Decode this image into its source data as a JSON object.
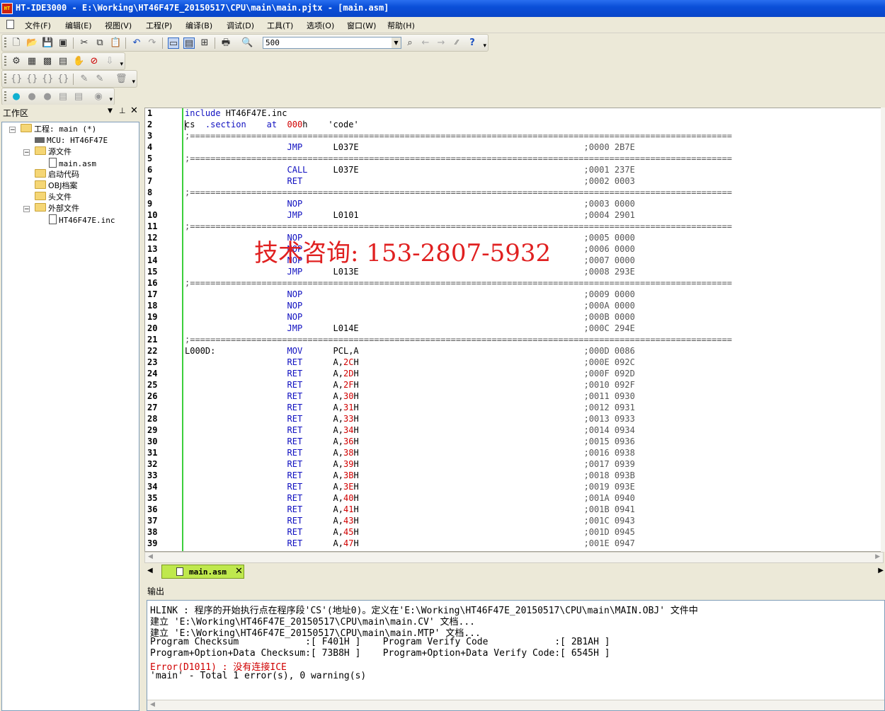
{
  "window": {
    "app_icon_text": "HT",
    "title": "HT-IDE3000 - E:\\Working\\HT46F47E_20150517\\CPU\\main\\main.pjtx - [main.asm]"
  },
  "menu": [
    "文件(F)",
    "编辑(E)",
    "视图(V)",
    "工程(P)",
    "编译(B)",
    "调试(D)",
    "工具(T)",
    "选项(O)",
    "窗口(W)",
    "帮助(H)"
  ],
  "toolbar": {
    "combo_value": "500"
  },
  "workspace": {
    "title": "工作区",
    "project": "工程: main (*)",
    "mcu": "MCU: HT46F47E",
    "source_folder": "源文件",
    "source_file": "main.asm",
    "startup_folder": "启动代码",
    "obj_folder": "OBJ档案",
    "header_folder": "头文件",
    "external_folder": "外部文件",
    "external_file": "HT46F47E.inc"
  },
  "editor": {
    "watermark": "技术咨询: 153-2807-5932",
    "separator": ";==========================================================================================================",
    "lines": [
      {
        "n": "1",
        "label": "include HT46F47E.inc",
        "op": "",
        "arg": "",
        "cmt": "",
        "dir": true
      },
      {
        "n": "2",
        "label": "cs  .section    at  000h    'code'",
        "op": "",
        "arg": "",
        "cmt": "",
        "dir": true,
        "special": "cs"
      },
      {
        "n": "3",
        "sep": true
      },
      {
        "n": "4",
        "label": "",
        "op": "JMP",
        "arg": "L037E",
        "cmt": ";0000 2B7E"
      },
      {
        "n": "5",
        "sep": true
      },
      {
        "n": "6",
        "label": "",
        "op": "CALL",
        "arg": "L037E",
        "cmt": ";0001 237E"
      },
      {
        "n": "7",
        "label": "",
        "op": "RET",
        "arg": "",
        "cmt": ";0002 0003"
      },
      {
        "n": "8",
        "sep": true
      },
      {
        "n": "9",
        "label": "",
        "op": "NOP",
        "arg": "",
        "cmt": ";0003 0000"
      },
      {
        "n": "10",
        "label": "",
        "op": "JMP",
        "arg": "L0101",
        "cmt": ";0004 2901"
      },
      {
        "n": "11",
        "sep": true
      },
      {
        "n": "12",
        "label": "",
        "op": "NOP",
        "arg": "",
        "cmt": ";0005 0000"
      },
      {
        "n": "13",
        "label": "",
        "op": "NOP",
        "arg": "",
        "cmt": ";0006 0000"
      },
      {
        "n": "14",
        "label": "",
        "op": "NOP",
        "arg": "",
        "cmt": ";0007 0000"
      },
      {
        "n": "15",
        "label": "",
        "op": "JMP",
        "arg": "L013E",
        "cmt": ";0008 293E"
      },
      {
        "n": "16",
        "sep": true
      },
      {
        "n": "17",
        "label": "",
        "op": "NOP",
        "arg": "",
        "cmt": ";0009 0000"
      },
      {
        "n": "18",
        "label": "",
        "op": "NOP",
        "arg": "",
        "cmt": ";000A 0000"
      },
      {
        "n": "19",
        "label": "",
        "op": "NOP",
        "arg": "",
        "cmt": ";000B 0000"
      },
      {
        "n": "20",
        "label": "",
        "op": "JMP",
        "arg": "L014E",
        "cmt": ";000C 294E"
      },
      {
        "n": "21",
        "sep": true
      },
      {
        "n": "22",
        "label": "L000D:",
        "op": "MOV",
        "arg": "PCL,A",
        "cmt": ";000D 0086"
      },
      {
        "n": "23",
        "label": "",
        "op": "RET",
        "arg": "A,2CH",
        "hex": "2C",
        "cmt": ";000E 092C"
      },
      {
        "n": "24",
        "label": "",
        "op": "RET",
        "arg": "A,2DH",
        "hex": "2D",
        "cmt": ";000F 092D"
      },
      {
        "n": "25",
        "label": "",
        "op": "RET",
        "arg": "A,2FH",
        "hex": "2F",
        "cmt": ";0010 092F"
      },
      {
        "n": "26",
        "label": "",
        "op": "RET",
        "arg": "A,30H",
        "hex": "30",
        "cmt": ";0011 0930"
      },
      {
        "n": "27",
        "label": "",
        "op": "RET",
        "arg": "A,31H",
        "hex": "31",
        "cmt": ";0012 0931"
      },
      {
        "n": "28",
        "label": "",
        "op": "RET",
        "arg": "A,33H",
        "hex": "33",
        "cmt": ";0013 0933"
      },
      {
        "n": "29",
        "label": "",
        "op": "RET",
        "arg": "A,34H",
        "hex": "34",
        "cmt": ";0014 0934"
      },
      {
        "n": "30",
        "label": "",
        "op": "RET",
        "arg": "A,36H",
        "hex": "36",
        "cmt": ";0015 0936"
      },
      {
        "n": "31",
        "label": "",
        "op": "RET",
        "arg": "A,38H",
        "hex": "38",
        "cmt": ";0016 0938"
      },
      {
        "n": "32",
        "label": "",
        "op": "RET",
        "arg": "A,39H",
        "hex": "39",
        "cmt": ";0017 0939"
      },
      {
        "n": "33",
        "label": "",
        "op": "RET",
        "arg": "A,3BH",
        "hex": "3B",
        "cmt": ";0018 093B"
      },
      {
        "n": "34",
        "label": "",
        "op": "RET",
        "arg": "A,3EH",
        "hex": "3E",
        "cmt": ";0019 093E"
      },
      {
        "n": "35",
        "label": "",
        "op": "RET",
        "arg": "A,40H",
        "hex": "40",
        "cmt": ";001A 0940"
      },
      {
        "n": "36",
        "label": "",
        "op": "RET",
        "arg": "A,41H",
        "hex": "41",
        "cmt": ";001B 0941"
      },
      {
        "n": "37",
        "label": "",
        "op": "RET",
        "arg": "A,43H",
        "hex": "43",
        "cmt": ";001C 0943"
      },
      {
        "n": "38",
        "label": "",
        "op": "RET",
        "arg": "A,45H",
        "hex": "45",
        "cmt": ";001D 0945"
      },
      {
        "n": "39",
        "label": "",
        "op": "RET",
        "arg": "A,47H",
        "hex": "47",
        "cmt": ";001E 0947"
      }
    ]
  },
  "tab": {
    "label": "main.asm"
  },
  "output": {
    "title": "输出",
    "lines": [
      {
        "text": "HLINK : 程序的开始执行点在程序段'CS'(地址0)。定义在'E:\\Working\\HT46F47E_20150517\\CPU\\main\\MAIN.OBJ' 文件中",
        "error": false
      },
      {
        "text": "建立 'E:\\Working\\HT46F47E_20150517\\CPU\\main\\main.CV' 文档...",
        "error": false
      },
      {
        "text": "建立 'E:\\Working\\HT46F47E_20150517\\CPU\\main\\main.MTP' 文档...",
        "error": false
      },
      {
        "text": "Program Checksum            :[ F401H ]    Program Verify Code            :[ 2B1AH ]",
        "error": false
      },
      {
        "text": "Program+Option+Data Checksum:[ 73B8H ]    Program+Option+Data Verify Code:[ 6545H ]",
        "error": false
      },
      {
        "text": "Error(D1011) : 没有连接ICE",
        "error": true
      },
      {
        "text": "'main' - Total 1 error(s), 0 warning(s)",
        "error": false
      }
    ]
  },
  "colors": {
    "keyword": "#1010c0",
    "number": "#d00000",
    "gutter_bar": "#3ccf3c",
    "tab_active": "#bfe84d",
    "title_bar": "#0a4fd8"
  }
}
